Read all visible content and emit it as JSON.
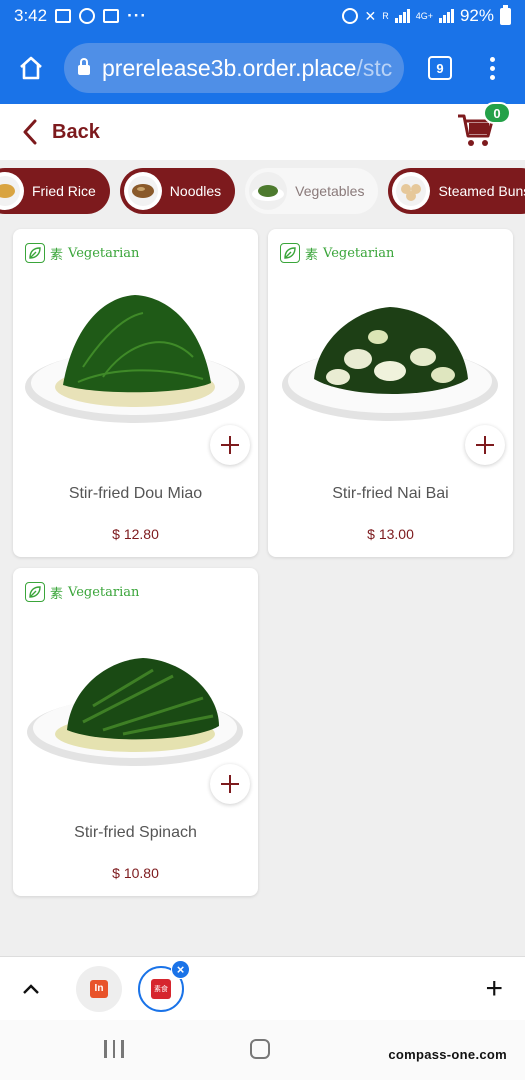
{
  "status_bar": {
    "time": "3:42",
    "network_label": "4G+",
    "roaming_label": "R",
    "battery": "92%"
  },
  "browser": {
    "url_host": "prerelease3b.order.place",
    "url_path": "/stc",
    "tab_count": "9"
  },
  "header": {
    "back_label": "Back",
    "cart_count": "0"
  },
  "categories": [
    {
      "label": "Fried Rice",
      "active": false
    },
    {
      "label": "Noodles",
      "active": false
    },
    {
      "label": "Vegetables",
      "active": true
    },
    {
      "label": "Steamed Buns",
      "active": false
    }
  ],
  "products": [
    {
      "tag_char": "素",
      "tag_label": "Vegetarian",
      "name": "Stir-fried Dou Miao",
      "price": "$ 12.80"
    },
    {
      "tag_char": "素",
      "tag_label": "Vegetarian",
      "name": "Stir-fried Nai Bai",
      "price": "$ 13.00"
    },
    {
      "tag_char": "素",
      "tag_label": "Vegetarian",
      "name": "Stir-fried Spinach",
      "price": "$ 10.80"
    }
  ],
  "bottom_tabs": {
    "app1_label": "In",
    "app2_label": "素食"
  },
  "watermark": "compass-one.com",
  "colors": {
    "brand": "#7d1a1d",
    "browser_blue": "#1a73e8",
    "vegetarian_green": "#3aa53a",
    "cart_badge_green": "#24a148"
  }
}
